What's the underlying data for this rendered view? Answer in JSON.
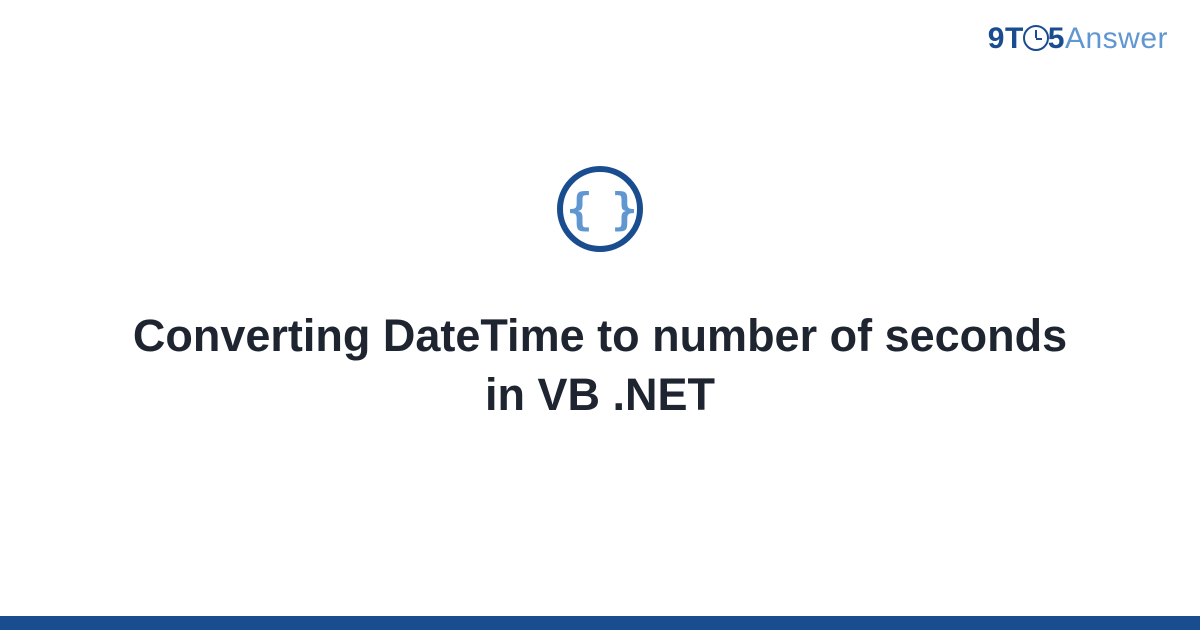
{
  "brand": {
    "part1": "9",
    "part2": "T",
    "part3": "5",
    "part4": "Answer"
  },
  "icon": {
    "braces": "{ }"
  },
  "title": "Converting DateTime to number of seconds in VB .NET"
}
